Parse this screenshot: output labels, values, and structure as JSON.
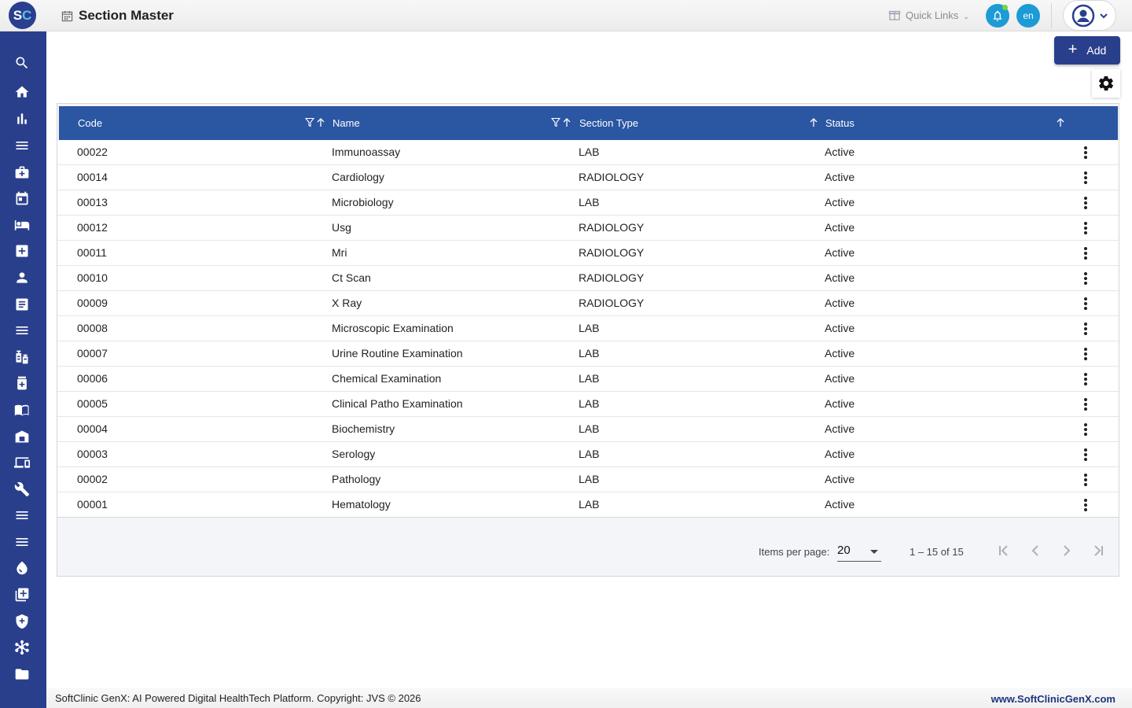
{
  "app": {
    "logo_s": "S",
    "logo_c": "C",
    "page_title": "Section Master"
  },
  "header": {
    "quick_links": "Quick Links",
    "lang": "en"
  },
  "actions": {
    "add_label": "Add"
  },
  "table": {
    "columns": [
      "Code",
      "Name",
      "Section Type",
      "Status"
    ],
    "rows": [
      {
        "code": "00022",
        "name": "Immunoassay",
        "type": "LAB",
        "status": "Active"
      },
      {
        "code": "00014",
        "name": "Cardiology",
        "type": "RADIOLOGY",
        "status": "Active"
      },
      {
        "code": "00013",
        "name": "Microbiology",
        "type": "LAB",
        "status": "Active"
      },
      {
        "code": "00012",
        "name": "Usg",
        "type": "RADIOLOGY",
        "status": "Active"
      },
      {
        "code": "00011",
        "name": "Mri",
        "type": "RADIOLOGY",
        "status": "Active"
      },
      {
        "code": "00010",
        "name": "Ct Scan",
        "type": "RADIOLOGY",
        "status": "Active"
      },
      {
        "code": "00009",
        "name": "X Ray",
        "type": "RADIOLOGY",
        "status": "Active"
      },
      {
        "code": "00008",
        "name": "Microscopic Examination",
        "type": "LAB",
        "status": "Active"
      },
      {
        "code": "00007",
        "name": "Urine Routine Examination",
        "type": "LAB",
        "status": "Active"
      },
      {
        "code": "00006",
        "name": "Chemical Examination",
        "type": "LAB",
        "status": "Active"
      },
      {
        "code": "00005",
        "name": "Clinical Patho Examination",
        "type": "LAB",
        "status": "Active"
      },
      {
        "code": "00004",
        "name": "Biochemistry",
        "type": "LAB",
        "status": "Active"
      },
      {
        "code": "00003",
        "name": "Serology",
        "type": "LAB",
        "status": "Active"
      },
      {
        "code": "00002",
        "name": "Pathology",
        "type": "LAB",
        "status": "Active"
      },
      {
        "code": "00001",
        "name": "Hematology",
        "type": "LAB",
        "status": "Active"
      }
    ]
  },
  "paginator": {
    "items_per_page_label": "Items per page:",
    "items_per_page": "20",
    "range": "1 – 15 of 15"
  },
  "sidebar": {
    "icons": [
      "search-icon",
      "home-icon",
      "bar-chart-icon",
      "menu-icon",
      "medical-bag-icon",
      "calendar-icon",
      "bed-icon",
      "medical-plus-icon",
      "person-icon",
      "document-list-icon",
      "menu-icon",
      "vaccine-icon",
      "pill-box-icon",
      "book-open-icon",
      "store-icon",
      "devices-icon",
      "wrench-icon",
      "menu-icon",
      "menu-icon",
      "drop-icon",
      "add-library-icon",
      "shield-plus-icon",
      "hub-icon",
      "folder-icon"
    ]
  },
  "footer": {
    "left": "SoftClinic GenX: AI Powered Digital HealthTech Platform. Copyright: JVS © 2026",
    "right": "www.SoftClinicGenX.com"
  },
  "colors": {
    "sidebar": "#2a3f8c",
    "table_header": "#2a56a2",
    "accent_blue": "#1d9bd6",
    "brand_link": "#1d3580"
  }
}
